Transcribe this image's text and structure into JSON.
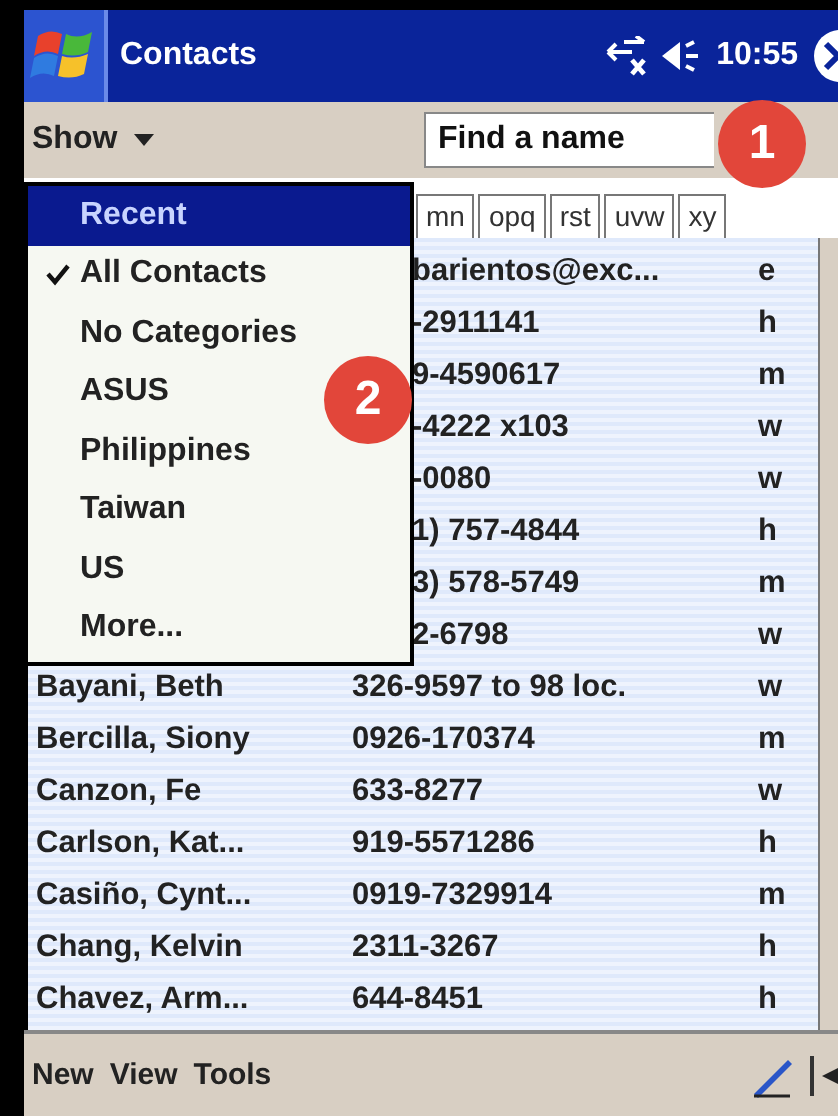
{
  "title_bar": {
    "title": "Contacts",
    "time": "10:55"
  },
  "show_bar": {
    "show_label": "Show",
    "search": {
      "placeholder": "Find a name"
    }
  },
  "letter_tabs": [
    {
      "label": "mn",
      "selected": false
    },
    {
      "label": "opq",
      "selected": false
    },
    {
      "label": "rst",
      "selected": false
    },
    {
      "label": "uvw",
      "selected": false
    },
    {
      "label": "xy",
      "selected": false
    }
  ],
  "contacts": [
    {
      "phone": "barientos@exc...",
      "type": "e"
    },
    {
      "phone": "-2911141",
      "type": "h"
    },
    {
      "phone": "9-4590617",
      "type": "m"
    },
    {
      "phone": "-4222 x103",
      "type": "w"
    },
    {
      "phone": "-0080",
      "type": "w"
    },
    {
      "phone": "1) 757-4844",
      "type": "h"
    },
    {
      "phone": "3) 578-5749",
      "type": "m"
    },
    {
      "phone": "2-6798",
      "type": "w"
    },
    {
      "name": "Bayani, Beth",
      "phone": "326-9597 to 98 loc.",
      "type": "w"
    },
    {
      "name": "Bercilla, Siony",
      "phone": "0926-170374",
      "type": "m"
    },
    {
      "name": "Canzon, Fe",
      "phone": "633-8277",
      "type": "w"
    },
    {
      "name": "Carlson, Kat...",
      "phone": "919-5571286",
      "type": "h"
    },
    {
      "name": "Casiño, Cynt...",
      "phone": "0919-7329914",
      "type": "m"
    },
    {
      "name": "Chang, Kelvin",
      "phone": "2311-3267",
      "type": "h"
    },
    {
      "name": "Chavez, Arm...",
      "phone": "644-8451",
      "type": "h"
    }
  ],
  "show_menu": [
    {
      "label": "Recent",
      "selected": true,
      "checked": false
    },
    {
      "label": "All Contacts",
      "selected": false,
      "checked": true
    },
    {
      "label": "No Categories",
      "selected": false,
      "checked": false
    },
    {
      "label": "ASUS",
      "selected": false,
      "checked": false
    },
    {
      "label": "Philippines",
      "selected": false,
      "checked": false
    },
    {
      "label": "Taiwan",
      "selected": false,
      "checked": false
    },
    {
      "label": "US",
      "selected": false,
      "checked": false
    },
    {
      "label": "More...",
      "selected": false,
      "checked": false
    }
  ],
  "menu_bar": [
    "New",
    "View",
    "Tools"
  ],
  "callouts": [
    "1",
    "2"
  ]
}
